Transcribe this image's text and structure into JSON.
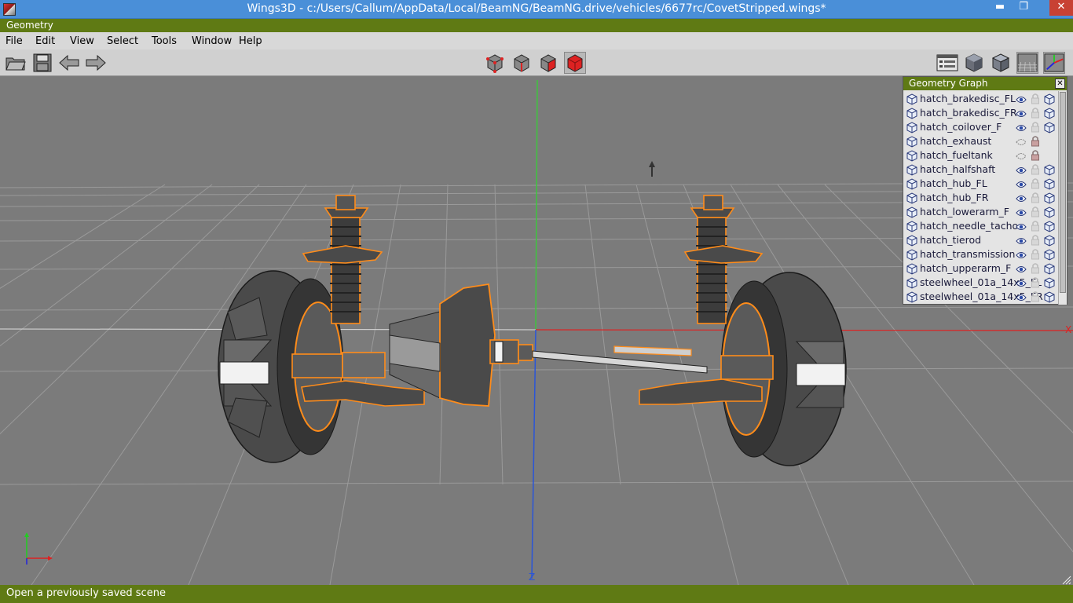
{
  "window": {
    "title": "Wings3D - c:/Users/Callum/AppData/Local/BeamNG/BeamNG.drive/vehicles/6677rc/CovetStripped.wings*",
    "min_glyph": "▬",
    "max_glyph": "❐",
    "close_glyph": "✕"
  },
  "geometry_strip": {
    "label": "Geometry"
  },
  "menu": {
    "items": [
      "File",
      "Edit",
      "View",
      "Select",
      "Tools",
      "Window",
      "Help"
    ]
  },
  "toolbar": {
    "left_icons": [
      "open-folder-icon",
      "save-disk-icon",
      "undo-arrow-icon",
      "redo-arrow-icon"
    ],
    "select_mode_icons": [
      "vertex-mode-icon",
      "edge-mode-icon",
      "face-mode-icon",
      "body-mode-icon"
    ],
    "active_select_mode": "body-mode-icon",
    "right_icons": [
      "outliner-icon",
      "smooth-shade-icon",
      "flat-shade-icon",
      "groundplane-icon",
      "axes-icon"
    ],
    "accent_color": "#dd2222"
  },
  "viewport": {
    "axis_labels": {
      "x": "X",
      "z": "Z"
    },
    "selection_color": "#ff8c1a",
    "background_color": "#7b7b7b"
  },
  "geometry_graph": {
    "title": "Geometry Graph",
    "close_glyph": "✕",
    "objects": [
      {
        "name": "hatch_brakedisc_FL",
        "visible": true,
        "locked": false,
        "wireframe_toggle": true
      },
      {
        "name": "hatch_brakedisc_FR",
        "visible": true,
        "locked": false,
        "wireframe_toggle": true
      },
      {
        "name": "hatch_coilover_F",
        "visible": true,
        "locked": false,
        "wireframe_toggle": true
      },
      {
        "name": "hatch_exhaust",
        "visible": false,
        "locked": true,
        "wireframe_toggle": false
      },
      {
        "name": "hatch_fueltank",
        "visible": false,
        "locked": true,
        "wireframe_toggle": false
      },
      {
        "name": "hatch_halfshaft",
        "visible": true,
        "locked": false,
        "wireframe_toggle": true
      },
      {
        "name": "hatch_hub_FL",
        "visible": true,
        "locked": false,
        "wireframe_toggle": true
      },
      {
        "name": "hatch_hub_FR",
        "visible": true,
        "locked": false,
        "wireframe_toggle": true
      },
      {
        "name": "hatch_lowerarm_F",
        "visible": true,
        "locked": false,
        "wireframe_toggle": true
      },
      {
        "name": "hatch_needle_tacho",
        "visible": true,
        "locked": false,
        "wireframe_toggle": true
      },
      {
        "name": "hatch_tierod",
        "visible": true,
        "locked": false,
        "wireframe_toggle": true
      },
      {
        "name": "hatch_transmission",
        "visible": true,
        "locked": false,
        "wireframe_toggle": true
      },
      {
        "name": "hatch_upperarm_F",
        "visible": true,
        "locked": false,
        "wireframe_toggle": true
      },
      {
        "name": "steelwheel_01a_14x5_FL",
        "visible": true,
        "locked": false,
        "wireframe_toggle": true
      },
      {
        "name": "steelwheel_01a_14x5_FR",
        "visible": true,
        "locked": false,
        "wireframe_toggle": true
      }
    ]
  },
  "status": {
    "message": "Open a previously saved scene"
  }
}
